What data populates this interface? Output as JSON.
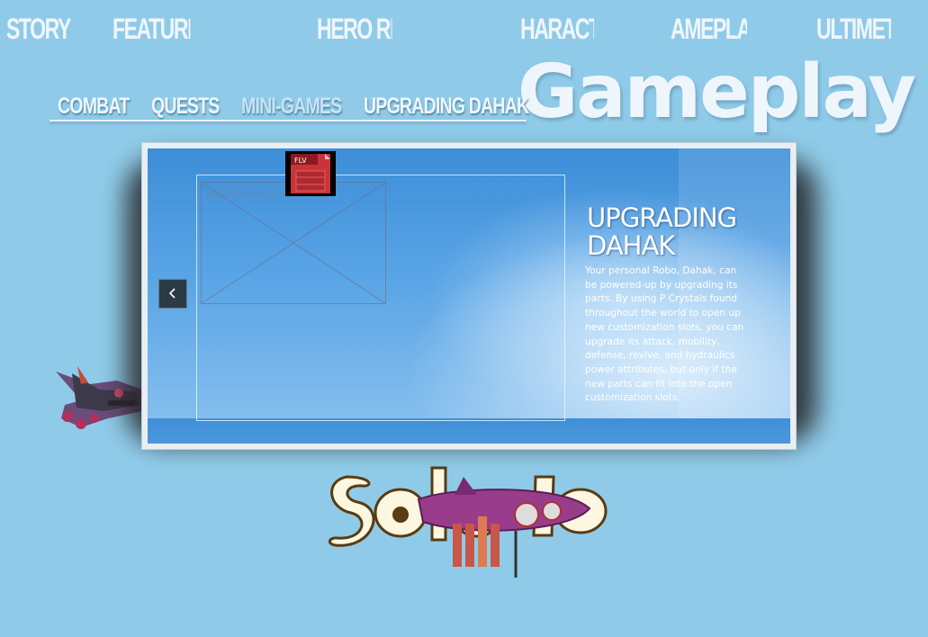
{
  "top_nav": {
    "items": [
      {
        "label": "STORY"
      },
      {
        "label": "FEATURE"
      },
      {
        "label": "HERO RI"
      },
      {
        "label": "HARACTE"
      },
      {
        "label": "AMEPLA"
      },
      {
        "label": "ULTIMET"
      }
    ]
  },
  "sub_nav": {
    "items": [
      {
        "label": "COMBAT"
      },
      {
        "label": "QUESTS"
      },
      {
        "label": "MINI-GAMES"
      },
      {
        "label": "UPGRADING DAHAK"
      }
    ]
  },
  "section_title": "Gameplay",
  "video": {
    "placeholder_label": "DefineVide          (child 10)",
    "flv_badge": "FLV"
  },
  "detail": {
    "title": "UPGRADING DAHAK",
    "body": "Your personal Robo, Dahak, can be powered-up by upgrading its parts. By using P Crystals found throughout the world to open up new customization slots, you can upgrade its attack, mobility, defense, revive, and hydraulics power attributes, but only if the new parts can fit into the open customization slots."
  },
  "prev_icon": "chevron-left-icon",
  "colors": {
    "background": "#8fcbe9",
    "panel_blue": "#3d8ed8",
    "nav_text": "#eef6fb",
    "logo_brown": "#5a3b12",
    "ship_purple": "#9a3c8c"
  }
}
